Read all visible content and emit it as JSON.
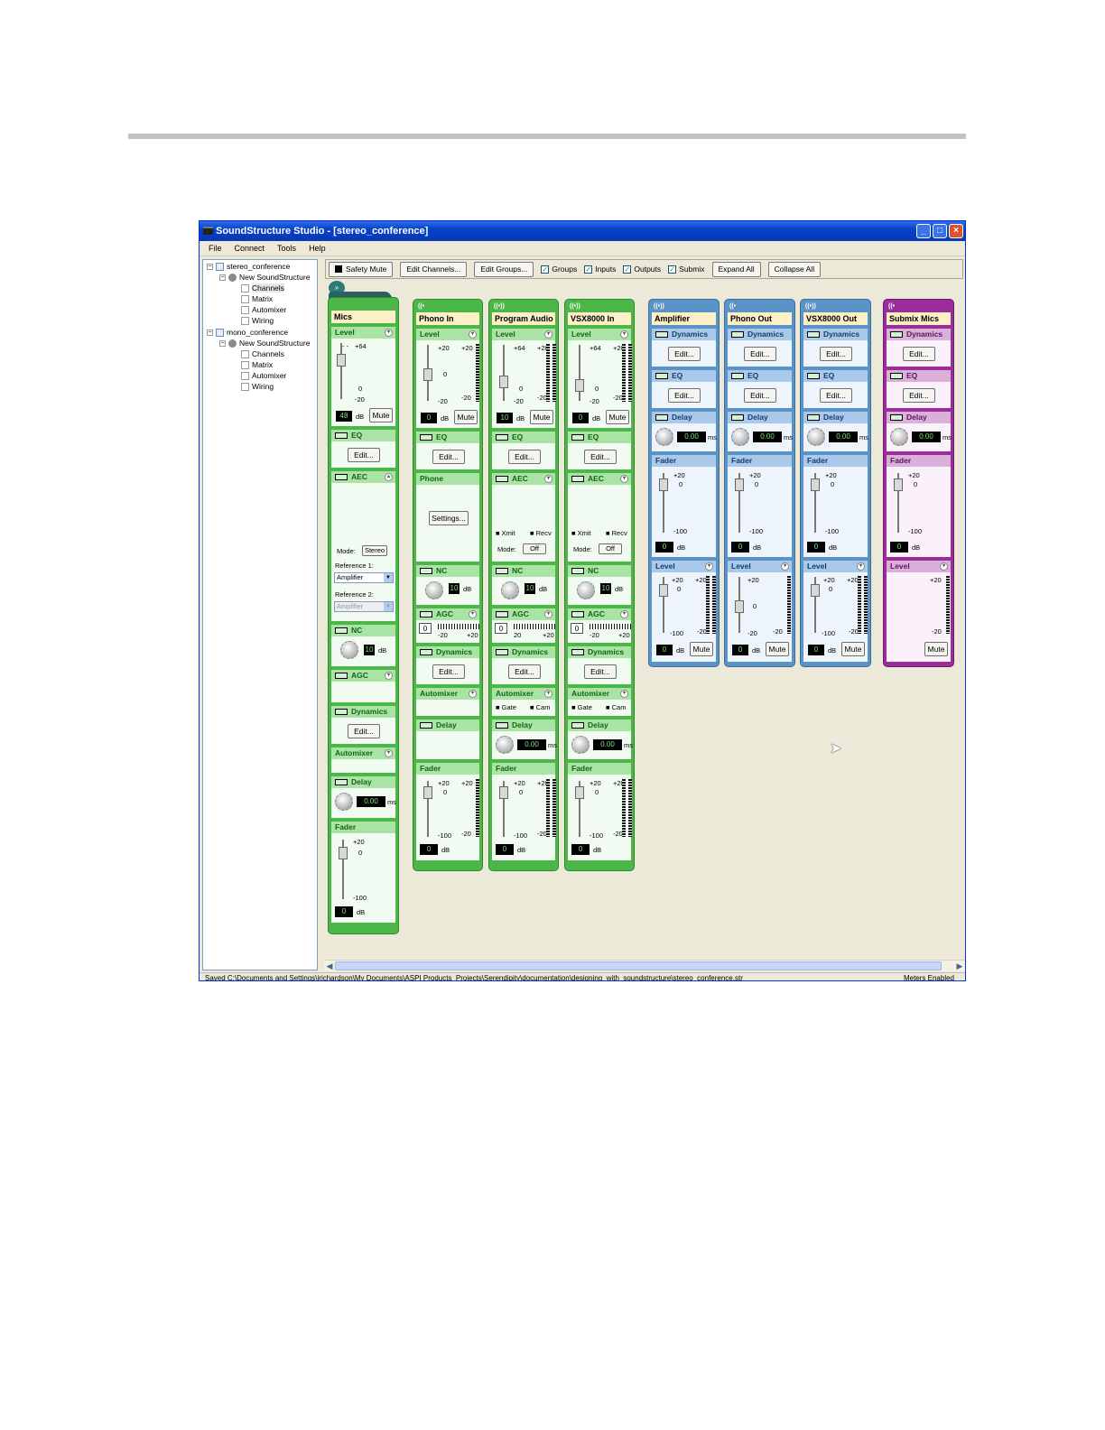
{
  "window": {
    "title": "SoundStructure Studio - [stereo_conference]"
  },
  "menu": [
    "File",
    "Connect",
    "Tools",
    "Help"
  ],
  "tree": {
    "project1": "stereo_conference",
    "device1": "New SoundStructure",
    "pages1": [
      "Channels",
      "Matrix",
      "Automixer",
      "Wiring"
    ],
    "project2": "mono_conference",
    "device2": "New SoundStructure",
    "pages2": [
      "Channels",
      "Matrix",
      "Automixer",
      "Wiring"
    ]
  },
  "toolbar": {
    "safety_mute": "Safety Mute",
    "edit_channels": "Edit Channels...",
    "edit_groups": "Edit Groups...",
    "groups": "Groups",
    "inputs": "Inputs",
    "outputs": "Outputs",
    "submix": "Submix",
    "expand_all": "Expand All",
    "collapse_all": "Collapse All"
  },
  "labels": {
    "level": "Level",
    "eq": "EQ",
    "aec": "AEC",
    "nc": "NC",
    "agc": "AGC",
    "dynamics": "Dynamics",
    "automixer": "Automixer",
    "delay": "Delay",
    "fader": "Fader",
    "phone": "Phone",
    "edit": "Edit...",
    "settings": "Settings...",
    "mute": "Mute",
    "db": "dB",
    "ms": "ms",
    "mode": "Mode:",
    "stereo": "Stereo",
    "off": "Off",
    "xmit": "Xmit",
    "recv": "Recv",
    "gate": "Gate",
    "cam": "Cam",
    "ref1": "Reference 1:",
    "ref2": "Reference 2:",
    "amplifier": "Amplifier",
    "p64": "+64",
    "p20": "+20",
    "zero": "0",
    "m20": "-20",
    "m100": "-100",
    "n20": "20",
    "dash": "- -"
  },
  "channels": {
    "mics": {
      "name": "Mics",
      "gain": "48",
      "nc": "10",
      "delay": "0.00",
      "fader": "0"
    },
    "phone_in": {
      "name": "Phono In",
      "gain": "0",
      "nc": "10",
      "agc": "0",
      "fader": "0"
    },
    "program": {
      "name": "Program Audio",
      "gain": "10",
      "nc": "10",
      "agc": "0",
      "delay": "0.00",
      "fader": "0"
    },
    "vsx_in": {
      "name": "VSX8000 In",
      "gain": "0",
      "nc": "10",
      "agc": "0",
      "delay": "0.00",
      "fader": "0"
    },
    "amp": {
      "name": "Amplifier",
      "delay": "0.00",
      "fader": "0",
      "level": "0"
    },
    "phone_out": {
      "name": "Phono Out",
      "delay": "0.00",
      "fader": "0",
      "level": "0"
    },
    "vsx_out": {
      "name": "VSX8000 Out",
      "delay": "0.00",
      "fader": "0",
      "level": "0"
    },
    "submix": {
      "name": "Submix Mics",
      "delay": "0.00",
      "fader": "0"
    }
  },
  "status": {
    "path": "Saved C:\\Documents and Settings\\jrichardson\\My Documents\\ASPI Products_Projects\\Serendipity\\documentation\\designing_with_soundstructure\\stereo_conference.str",
    "meters": "Meters Enabled"
  },
  "colors": {
    "input": "#4cb648",
    "output": "#5c93c6",
    "submix": "#9b2d9b",
    "titlebar": "#0842c8"
  }
}
